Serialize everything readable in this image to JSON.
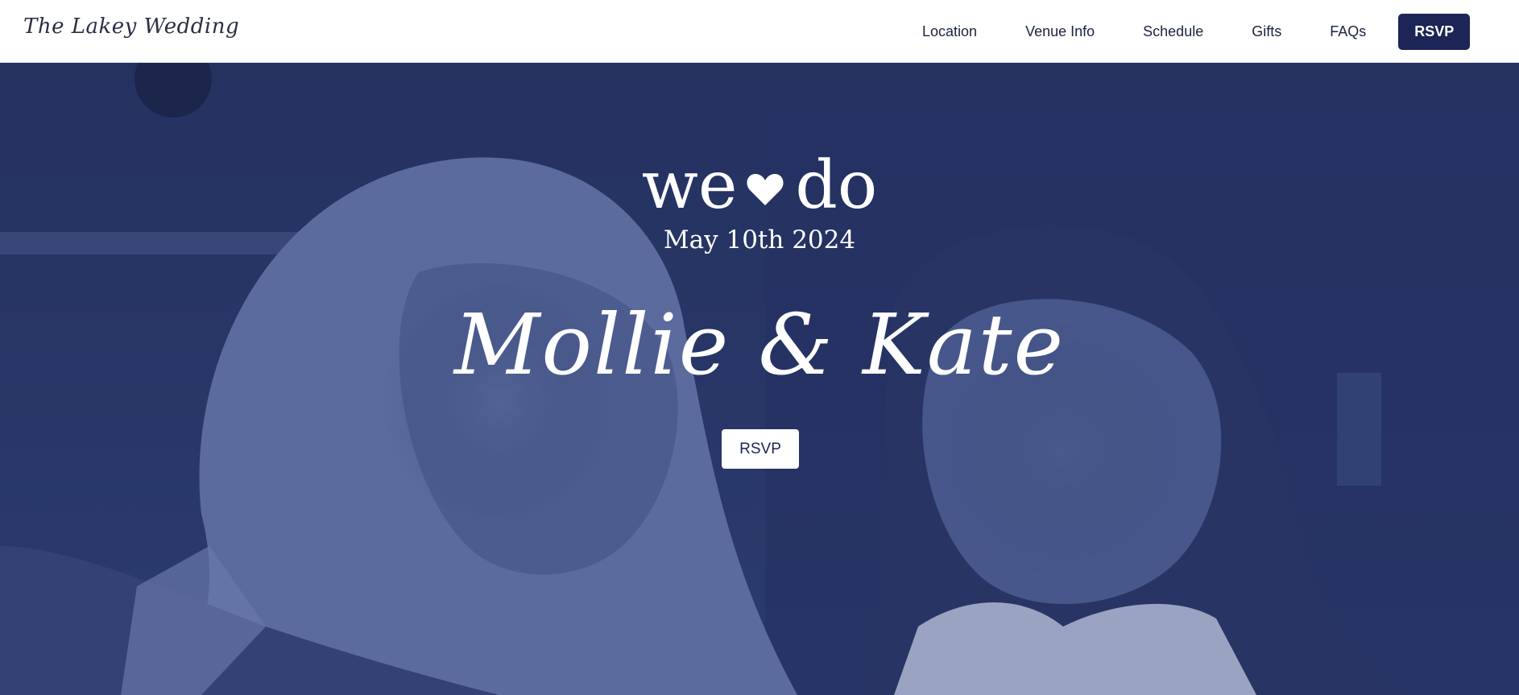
{
  "header": {
    "logo_text": "The Lakey Wedding",
    "nav": [
      {
        "label": "Location"
      },
      {
        "label": "Venue Info"
      },
      {
        "label": "Schedule"
      },
      {
        "label": "Gifts"
      },
      {
        "label": "FAQs"
      }
    ],
    "rsvp_label": "RSVP"
  },
  "hero": {
    "we_word": "we",
    "do_word": "do",
    "heart_icon": "heart-icon",
    "date": "May 10th 2024",
    "names": "Mollie & Kate",
    "rsvp_label": "RSVP"
  },
  "colors": {
    "navy": "#1c2555",
    "hero_tint": "#2c3a67",
    "white": "#ffffff"
  }
}
